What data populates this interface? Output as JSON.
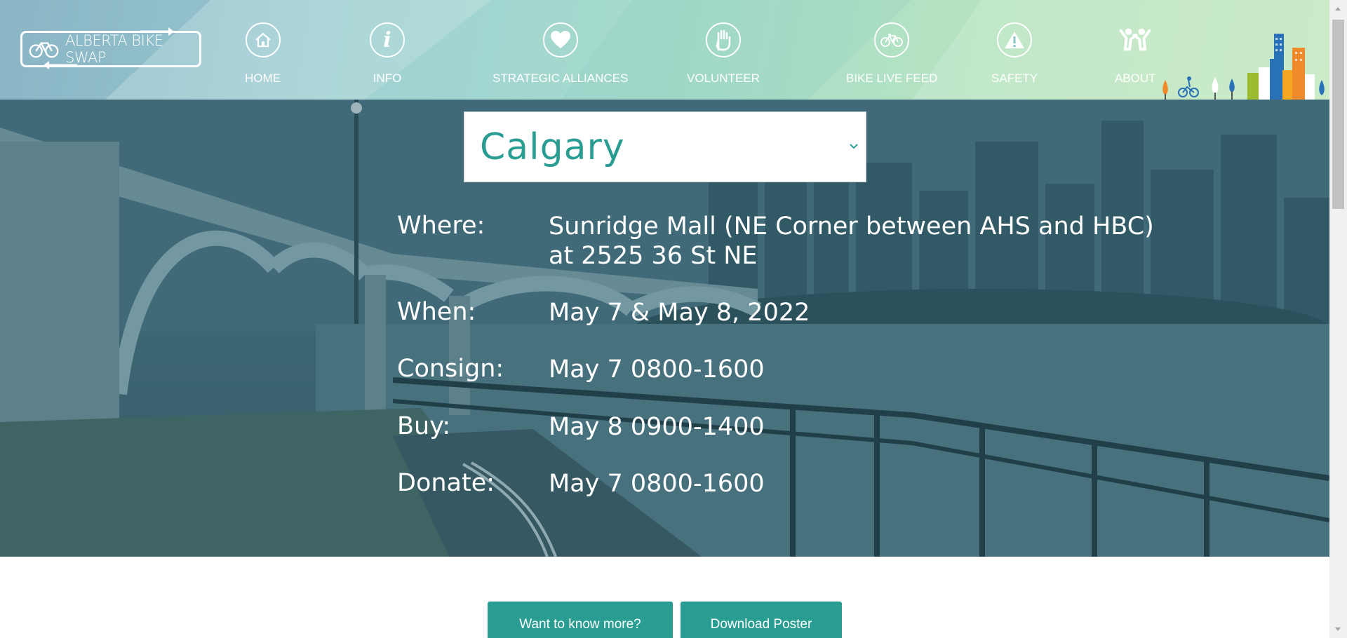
{
  "logo": {
    "text": "ALBERTA BIKE SWAP"
  },
  "nav": [
    {
      "label": "HOME",
      "icon": "home-icon"
    },
    {
      "label": "INFO",
      "icon": "info-icon"
    },
    {
      "label": "STRATEGIC ALLIANCES",
      "icon": "heart-icon"
    },
    {
      "label": "VOLUNTEER",
      "icon": "raised-hand-icon"
    },
    {
      "label": "BIKE LIVE FEED",
      "icon": "bicycle-icon"
    },
    {
      "label": "SAFETY",
      "icon": "warning-icon"
    },
    {
      "label": "ABOUT",
      "icon": "people-icon"
    }
  ],
  "city_select": {
    "value": "Calgary"
  },
  "event": {
    "where_label": "Where:",
    "where_value": "Sunridge Mall (NE Corner between AHS and HBC) at 2525 36 St NE",
    "when_label": "When:",
    "when_value": "May 7 & May 8, 2022",
    "consign_label": "Consign:",
    "consign_value": "May 7 0800-1600",
    "buy_label": "Buy:",
    "buy_value": "May 8 0900-1400",
    "donate_label": "Donate:",
    "donate_value": "May 7 0800-1600"
  },
  "buttons": {
    "more": "Want to know more?",
    "poster": "Download Poster"
  },
  "colors": {
    "accent": "#2a9d93",
    "hero_overlay": "#3b5f6a"
  }
}
